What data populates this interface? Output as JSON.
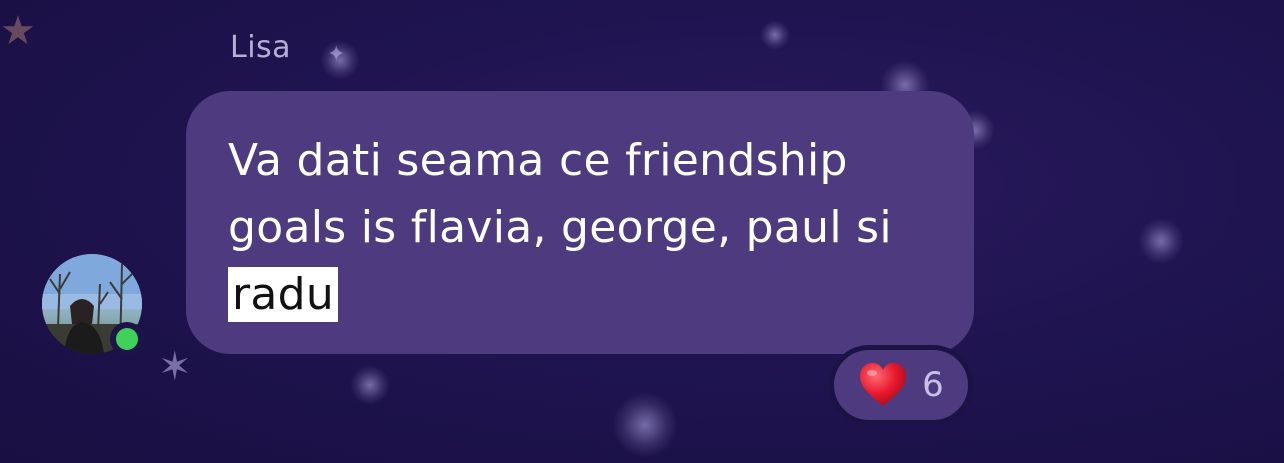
{
  "message": {
    "sender": "Lisa",
    "text_lines": [
      "Va dati seama ce friendship",
      "goals is flavia, george, paul si"
    ],
    "mention": "radu"
  },
  "reaction": {
    "icon": "heart-icon",
    "count": "6",
    "color": "#e8192c"
  },
  "status": {
    "online": true,
    "color": "#3fd15a"
  },
  "colors": {
    "background": "#1f1450",
    "bubble": "#4e3a7e",
    "username": "#b7aed8"
  }
}
